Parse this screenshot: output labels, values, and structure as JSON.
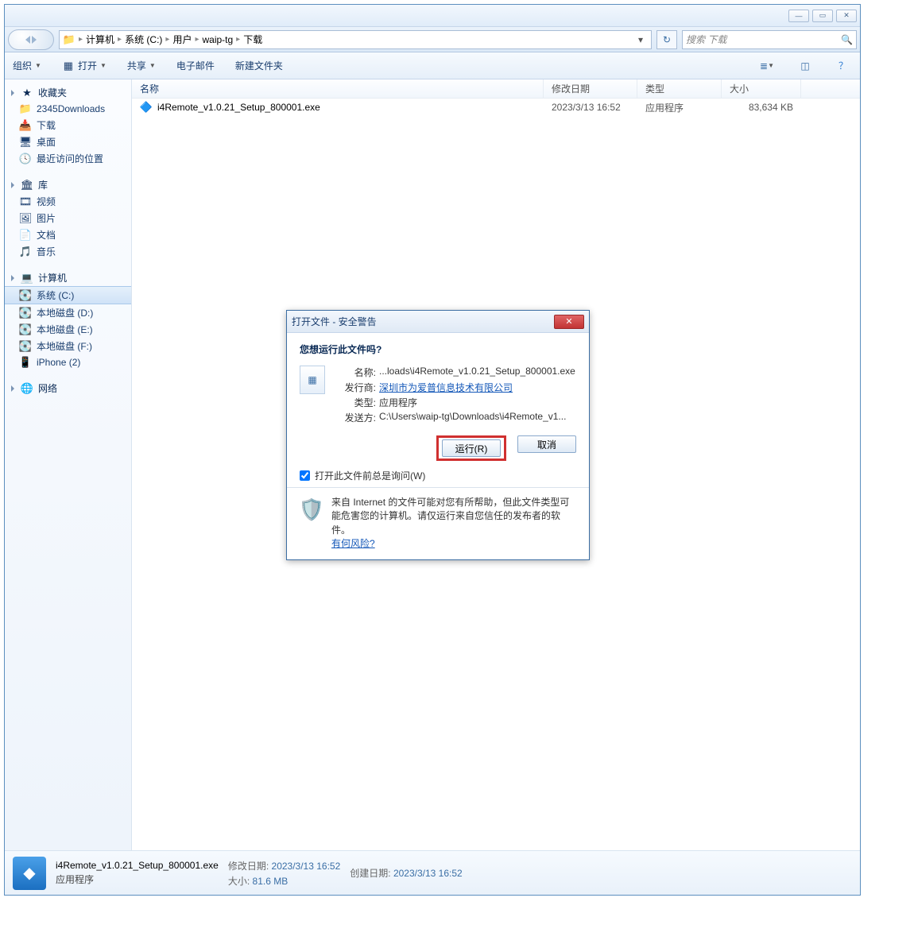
{
  "titlebar": {
    "min": "—",
    "max": "▭",
    "close": "✕"
  },
  "breadcrumbs": [
    "计算机",
    "系统 (C:)",
    "用户",
    "waip-tg",
    "下载"
  ],
  "search_placeholder": "搜索 下载",
  "toolbar": {
    "organize": "组织",
    "open": "打开",
    "share": "共享",
    "email": "电子邮件",
    "new_folder": "新建文件夹"
  },
  "columns": {
    "name": "名称",
    "date": "修改日期",
    "type": "类型",
    "size": "大小"
  },
  "sidebar": {
    "favorites": {
      "label": "收藏夹",
      "items": [
        "2345Downloads",
        "下载",
        "桌面",
        "最近访问的位置"
      ]
    },
    "libraries": {
      "label": "库",
      "items": [
        "视频",
        "图片",
        "文档",
        "音乐"
      ]
    },
    "computer": {
      "label": "计算机",
      "items": [
        "系统 (C:)",
        "本地磁盘 (D:)",
        "本地磁盘 (E:)",
        "本地磁盘 (F:)",
        "iPhone (2)"
      ]
    },
    "network": {
      "label": "网络"
    }
  },
  "files": [
    {
      "name": "i4Remote_v1.0.21_Setup_800001.exe",
      "date": "2023/3/13 16:52",
      "type": "应用程序",
      "size": "83,634 KB"
    }
  ],
  "detail": {
    "name": "i4Remote_v1.0.21_Setup_800001.exe",
    "type": "应用程序",
    "mdate_label": "修改日期:",
    "mdate": "2023/3/13 16:52",
    "cdate_label": "创建日期:",
    "cdate": "2023/3/13 16:52",
    "size_label": "大小:",
    "size": "81.6 MB"
  },
  "dialog": {
    "title": "打开文件 - 安全警告",
    "question": "您想运行此文件吗?",
    "labels": {
      "name": "名称:",
      "publisher": "发行商:",
      "type": "类型:",
      "from": "发送方:"
    },
    "name_val": "...loads\\i4Remote_v1.0.21_Setup_800001.exe",
    "publisher_val": "深圳市为爱普信息技术有限公司",
    "type_val": "应用程序",
    "from_val": "C:\\Users\\waip-tg\\Downloads\\i4Remote_v1...",
    "run_btn": "运行(R)",
    "cancel_btn": "取消",
    "always_ask": "打开此文件前总是询问(W)",
    "warn_text": "来自 Internet 的文件可能对您有所帮助，但此文件类型可能危害您的计算机。请仅运行来自您信任的发布者的软件。",
    "risk_link": "有何风险?"
  }
}
